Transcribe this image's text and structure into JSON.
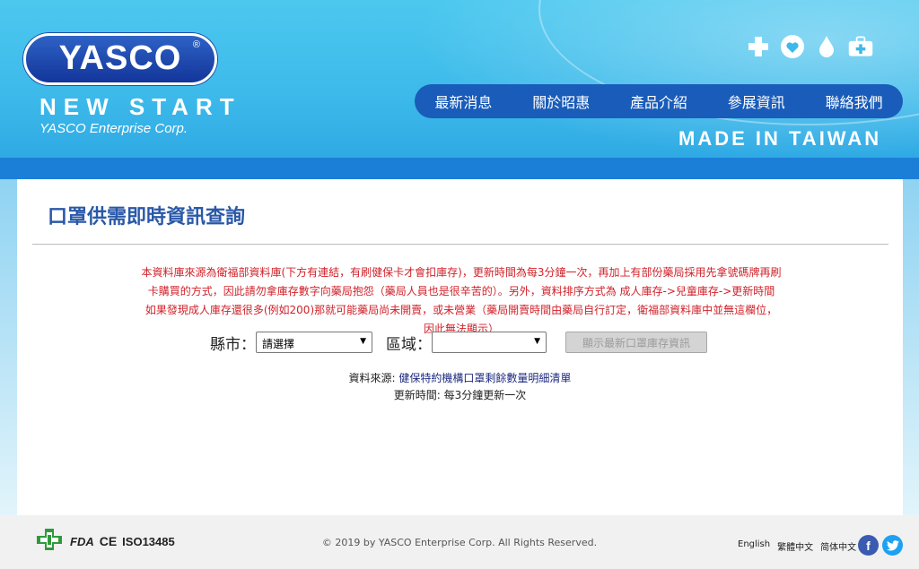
{
  "brand": {
    "logo_text": "YASCO",
    "registered": "®",
    "tagline": "NEW START",
    "corp": "YASCO Enterprise Corp.",
    "made_in": "MADE IN TAIWAN"
  },
  "header_icons": [
    "plus-icon",
    "heart-icon",
    "drop-icon",
    "first-aid-kit-icon"
  ],
  "nav": [
    "最新消息",
    "關於昭惠",
    "產品介紹",
    "參展資訊",
    "聯絡我們"
  ],
  "page": {
    "title": "口罩供需即時資訊查詢",
    "notice_lines": [
      "本資料庫來源為衛福部資料庫(下方有連結，有刷健保卡才會扣庫存)，更新時間為每3分鐘一次，再加上有部份藥局採用先拿號碼牌再刷",
      "卡購買的方式，因此請勿拿庫存數字向藥局抱怨（藥局人員也是很辛苦的）。另外，資料排序方式為 成人庫存->兒童庫存->更新時間",
      "如果發現成人庫存還很多(例如200)那就可能藥局尚未開賣，或未營業（藥局開賣時間由藥局自行訂定，衛福部資料庫中並無這欄位，",
      "因此無法顯示）"
    ],
    "county_label": "縣市：",
    "county_value": "請選擇",
    "district_label": "區域：",
    "district_value": "",
    "show_button": "顯示最新口罩庫存資訊",
    "source_label": "資料來源:",
    "source_link": "健保特約機構口罩剩餘數量明細清單",
    "update_text": "更新時間: 每3分鐘更新一次"
  },
  "footer": {
    "fda": "FDA",
    "ce": "CE",
    "iso": "ISO13485",
    "copyright": "© 2019 by YASCO Enterprise Corp. All Rights Reserved.",
    "langs": [
      "English",
      "繁體中文",
      "简体中文"
    ],
    "social": [
      {
        "name": "facebook",
        "glyph": "f",
        "color": "#3b5bb0"
      },
      {
        "name": "twitter",
        "glyph": "t",
        "color": "#1da1f2"
      }
    ]
  }
}
